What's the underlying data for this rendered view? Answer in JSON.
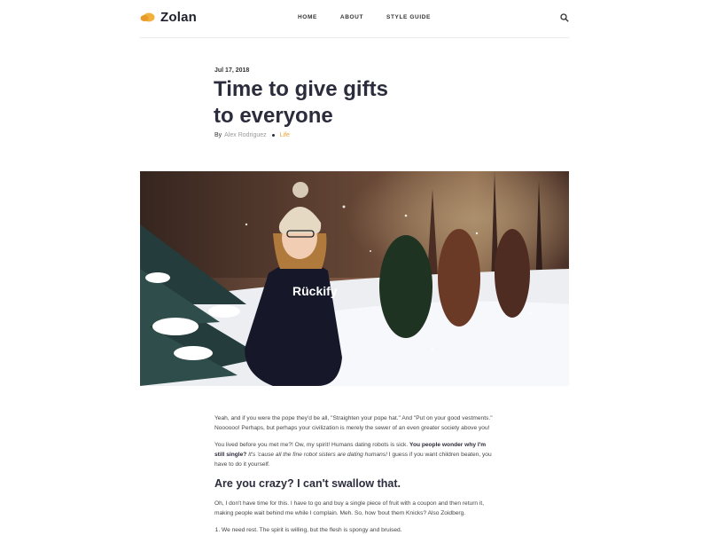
{
  "header": {
    "logo_text": "Zolan",
    "nav": [
      "HOME",
      "ABOUT",
      "STYLE GUIDE"
    ],
    "search_icon": "search-icon"
  },
  "post": {
    "date": "Jul 17, 2018",
    "title_line1": "Time to give gifts",
    "title_line2": "to everyone",
    "by_label": "By",
    "author": "Alex Rodriguez",
    "category": "Life"
  },
  "hero": {
    "sweater_text": "Rückify"
  },
  "body": {
    "p1": "Yeah, and if you were the pope they'd be all, \"Straighten your pope hat.\" And \"Put on your good vestments.\" Noooooo! Perhaps, but perhaps your civilization is merely the sewer of an even greater society above you!",
    "p2_a": "You lived before you met me?! Ow, my spirit! Humans dating robots is sick.",
    "p2_bold": "You people wonder why I'm still single?",
    "p2_italic": "It's 'cause all the fine robot sisters are dating humans!",
    "p2_b": "I guess if you want children beaten, you have to do it yourself.",
    "h2": "Are you crazy? I can't swallow that.",
    "p3": "Oh, I don't have time for this. I have to go and buy a single piece of fruit with a coupon and then return it, making people wait behind me while I complain. Meh. So, how 'bout them Knicks? Also Zoidberg.",
    "li1": "We need rest. The spirit is willing, but the flesh is spongy and bruised."
  },
  "colors": {
    "accent": "#e8a33a",
    "text": "#2b2d3c",
    "muted": "#9a9a9a"
  }
}
